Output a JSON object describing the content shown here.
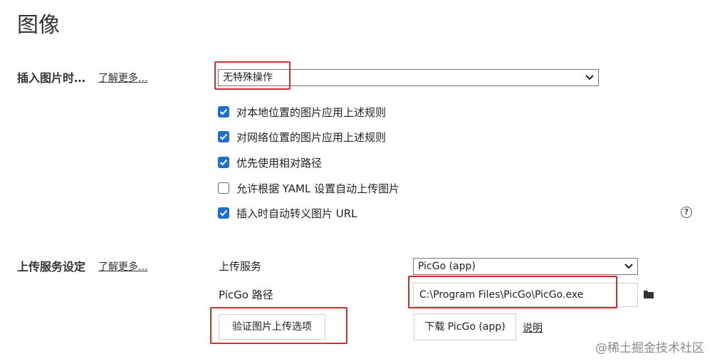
{
  "page": {
    "title": "图像"
  },
  "insert_section": {
    "label": "插入图片时…",
    "learn_more": "了解更多...",
    "select_value": "无特殊操作",
    "checkboxes": [
      {
        "label": "对本地位置的图片应用上述规则",
        "checked": true
      },
      {
        "label": "对网络位置的图片应用上述规则",
        "checked": true
      },
      {
        "label": "优先使用相对路径",
        "checked": true
      },
      {
        "label": "允许根据 YAML 设置自动上传图片",
        "checked": false
      },
      {
        "label": "插入时自动转义图片 URL",
        "checked": true
      }
    ],
    "help_icon": "?"
  },
  "upload_section": {
    "label": "上传服务设定",
    "learn_more": "了解更多...",
    "service_label": "上传服务",
    "service_value": "PicGo (app)",
    "path_label": "PicGo 路径",
    "path_value": "C:\\Program Files\\PicGo\\PicGo.exe",
    "verify_button": "验证图片上传选项",
    "download_button": "下载 PicGo (app)",
    "explain_link": "说明"
  },
  "watermark": "@稀土掘金技术社区",
  "colors": {
    "highlight": "#d32f2f",
    "checkbox": "#1f6fd1"
  }
}
